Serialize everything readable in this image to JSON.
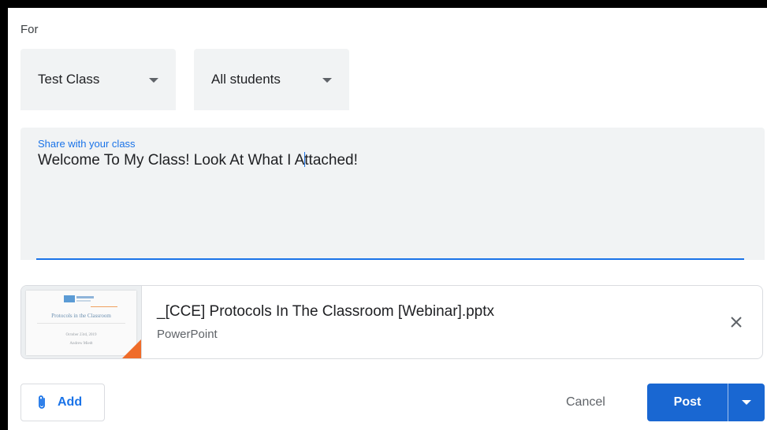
{
  "for_label": "For",
  "class_select": {
    "value": "Test Class"
  },
  "students_select": {
    "value": "All students"
  },
  "share": {
    "label": "Share with your class",
    "text_before_cursor": "Welcome To My Class! Look At What I A",
    "text_after_cursor": "ttached!"
  },
  "attachment": {
    "file_name": "_[CCE] Protocols In The Classroom [Webinar].pptx",
    "file_type": "PowerPoint",
    "thumbnail": {
      "slide_title": "Protocols in the Classroom",
      "slide_date": "October 23rd, 2019",
      "slide_author": "Andrew Miedt"
    }
  },
  "actions": {
    "add_label": "Add",
    "cancel_label": "Cancel",
    "post_label": "Post"
  },
  "colors": {
    "accent": "#1a73e8",
    "post_button": "#1967d2",
    "field_bg": "#f1f3f4",
    "thumb_corner": "#ef6c29"
  },
  "icons": {
    "select_caret": "caret-down-icon",
    "add": "paperclip-icon",
    "remove": "close-icon",
    "post_menu": "caret-down-icon"
  }
}
